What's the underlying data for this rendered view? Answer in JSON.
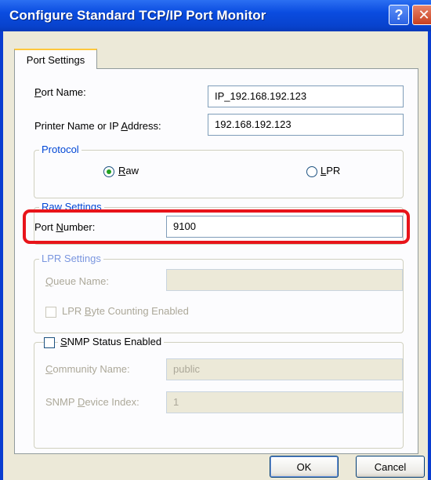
{
  "window": {
    "title": "Configure Standard TCP/IP Port Monitor",
    "help_glyph": "?",
    "close_glyph": "✕"
  },
  "tabs": [
    {
      "label": "Port Settings",
      "selected": true
    }
  ],
  "port_settings": {
    "port_name": {
      "label": "Port Name:",
      "mnemonic": "P",
      "rest": "ort Name:",
      "value": "IP_192.168.192.123"
    },
    "printer_name": {
      "label_prefix": "Printer Name or IP ",
      "mnemonic": "A",
      "label_suffix": "ddress:",
      "value": "192.168.192.123"
    }
  },
  "protocol": {
    "title": "Protocol",
    "options": [
      {
        "mnemonic": "R",
        "rest": "aw",
        "selected": true
      },
      {
        "mnemonic": "L",
        "rest": "PR",
        "selected": false
      }
    ]
  },
  "raw_settings": {
    "title": "Raw Settings",
    "port_number": {
      "label_prefix": "Port ",
      "mnemonic": "N",
      "label_suffix": "umber:",
      "value": "9100"
    }
  },
  "lpr_settings": {
    "title": "LPR Settings",
    "queue_name": {
      "mnemonic": "Q",
      "rest": "ueue Name:",
      "value": ""
    },
    "byte_counting": {
      "prefix": "LPR ",
      "mnemonic": "B",
      "suffix": "yte Counting Enabled",
      "checked": false
    }
  },
  "snmp": {
    "status": {
      "mnemonic": "S",
      "rest": "NMP Status Enabled",
      "checked": false
    },
    "community_name": {
      "mnemonic": "C",
      "rest": "ommunity Name:",
      "value": "public"
    },
    "device_index": {
      "prefix": "SNMP ",
      "mnemonic": "D",
      "suffix": "evice Index:",
      "value": "1"
    }
  },
  "buttons": {
    "ok": "OK",
    "cancel": "Cancel"
  },
  "colors": {
    "titlebar": "#0a4ce0",
    "dialog_bg": "#ece9d8",
    "highlight": "#e8141a",
    "group_title": "#0046d5"
  }
}
